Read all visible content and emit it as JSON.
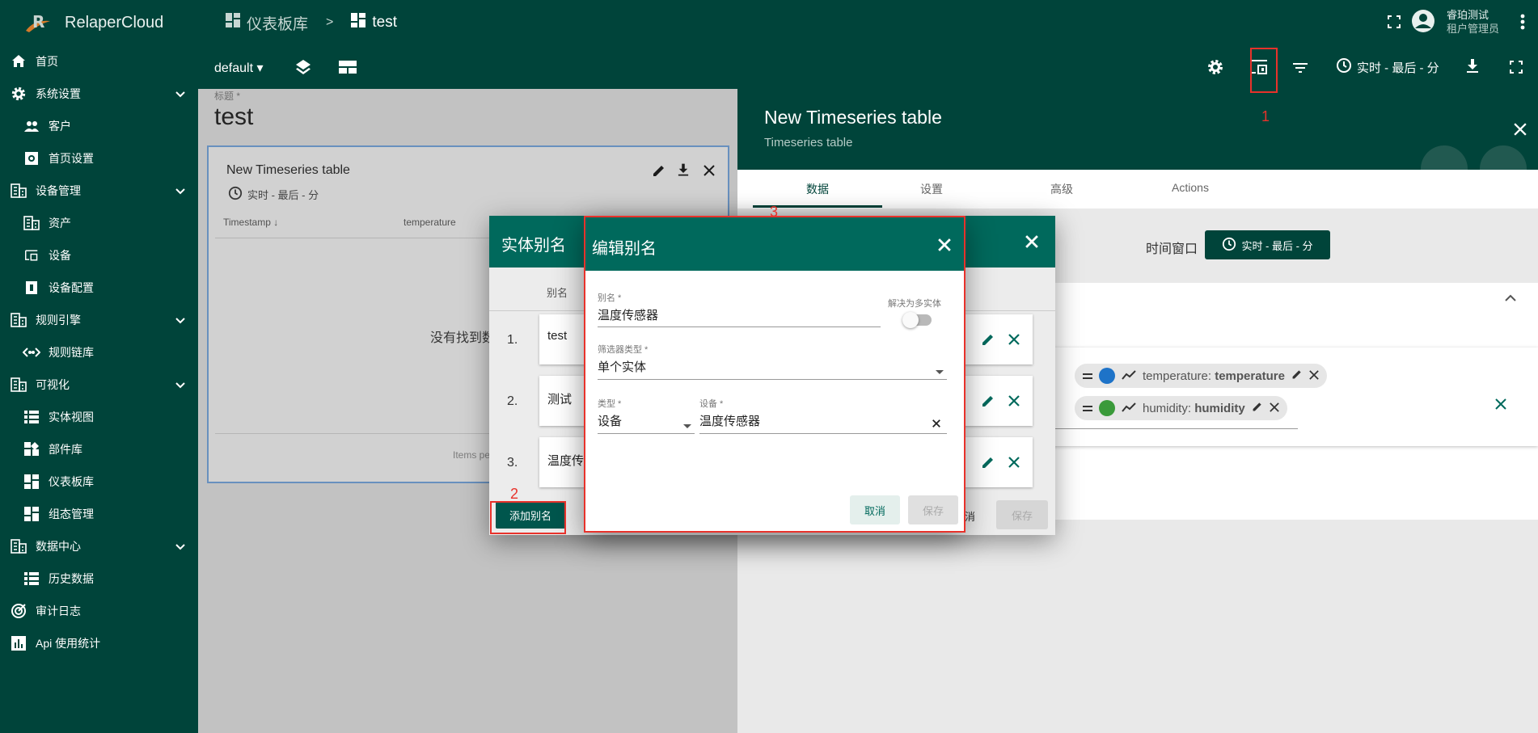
{
  "brand": "RelaperCloud",
  "sidebar": {
    "items": [
      {
        "label": "首页",
        "icon": "home-icon",
        "type": "top"
      },
      {
        "label": "系统设置",
        "icon": "gear-icon",
        "type": "top",
        "expandable": true
      },
      {
        "label": "客户",
        "icon": "people-icon",
        "type": "sub"
      },
      {
        "label": "首页设置",
        "icon": "settings-box-icon",
        "type": "sub"
      },
      {
        "label": "设备管理",
        "icon": "building-icon",
        "type": "top",
        "expandable": true
      },
      {
        "label": "资产",
        "icon": "building-icon",
        "type": "sub"
      },
      {
        "label": "设备",
        "icon": "devices-icon",
        "type": "sub"
      },
      {
        "label": "设备配置",
        "icon": "profile-icon",
        "type": "sub"
      },
      {
        "label": "规则引擎",
        "icon": "building-icon",
        "type": "top",
        "expandable": true
      },
      {
        "label": "规则链库",
        "icon": "code-icon",
        "type": "sub"
      },
      {
        "label": "可视化",
        "icon": "building-icon",
        "type": "top",
        "expandable": true
      },
      {
        "label": "实体视图",
        "icon": "grid-icon",
        "type": "sub"
      },
      {
        "label": "部件库",
        "icon": "widgets-icon",
        "type": "sub"
      },
      {
        "label": "仪表板库",
        "icon": "dashboard-icon",
        "type": "sub"
      },
      {
        "label": "组态管理",
        "icon": "dashboard-icon",
        "type": "sub"
      },
      {
        "label": "数据中心",
        "icon": "building-icon",
        "type": "top",
        "expandable": true
      },
      {
        "label": "历史数据",
        "icon": "grid-icon",
        "type": "sub"
      },
      {
        "label": "审计日志",
        "icon": "track-icon",
        "type": "top"
      },
      {
        "label": "Api 使用统计",
        "icon": "bar-chart-icon",
        "type": "top"
      }
    ]
  },
  "header": {
    "crumb_root": "仪表板库",
    "crumb_sep": ">",
    "crumb_current": "test",
    "user_name": "睿珀测试",
    "user_role": "租户管理员"
  },
  "toolbar": {
    "state": "default",
    "timewindow": "实时 - 最后 - 分"
  },
  "dashboard": {
    "title_label": "标题 *",
    "title": "test",
    "widget": {
      "title": "New Timeseries table",
      "timewindow": "实时 - 最后 - 分",
      "columns": [
        "Timestamp",
        "temperature"
      ],
      "no_data": "没有找到数",
      "footer": "Items pe"
    }
  },
  "panel": {
    "title": "New Timeseries table",
    "subtitle": "Timeseries table",
    "tabs": [
      "数据",
      "设置",
      "高级",
      "Actions"
    ],
    "timewindow_label": "时间窗口",
    "timewindow_value": "实时 - 最后 - 分",
    "keys": [
      {
        "prefix": "temperature: ",
        "bold": "temperature",
        "color": "#1e73c8"
      },
      {
        "prefix": "humidity: ",
        "bold": "humidity",
        "color": "#3a9a3a"
      }
    ]
  },
  "aliases_dialog": {
    "title": "实体别名",
    "col_header": "别名",
    "rows": [
      {
        "num": "1.",
        "name": "test"
      },
      {
        "num": "2.",
        "name": "测试"
      },
      {
        "num": "3.",
        "name": "温度传"
      }
    ],
    "add_button": "添加别名",
    "cancel_partial": "消",
    "save_button": "保存"
  },
  "edit_dialog": {
    "title": "编辑别名",
    "alias_label": "别名 *",
    "alias_value": "温度传感器",
    "multi_label": "解决为多实体",
    "filter_label": "筛选器类型 *",
    "filter_value": "单个实体",
    "type_label": "类型 *",
    "type_value": "设备",
    "device_label": "设备 *",
    "device_value": "温度传感器",
    "cancel": "取消",
    "save": "保存"
  },
  "annotations": [
    "1",
    "2",
    "3"
  ],
  "colors": {
    "primary": "#00443a",
    "dialog": "#00695c",
    "annotation": "#e8322b"
  }
}
